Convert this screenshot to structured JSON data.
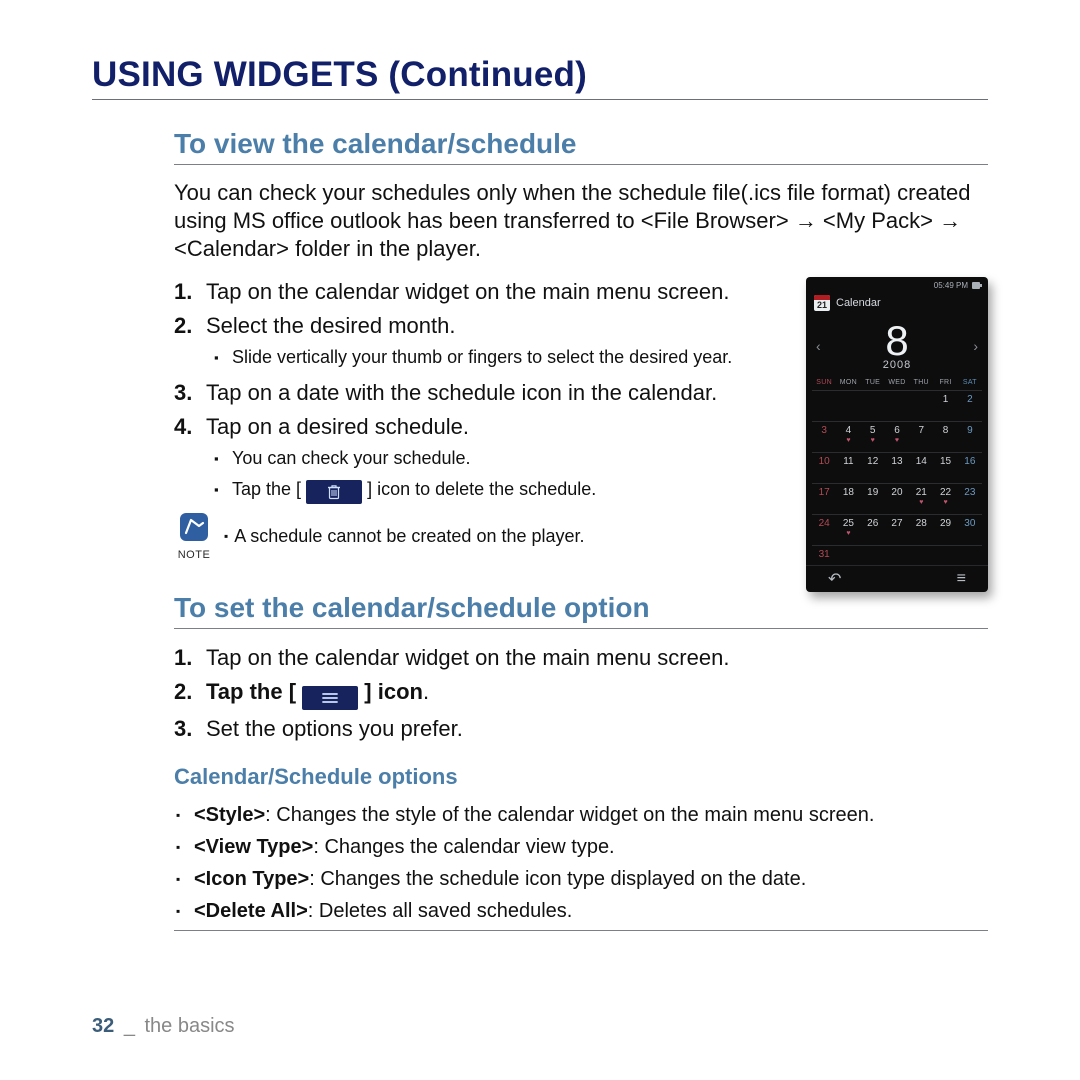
{
  "heading": "USING WIDGETS (Continued)",
  "section1": {
    "title": "To view the calendar/schedule",
    "intro": "You can check your schedules only when the schedule file(.ics file format) created using MS office outlook has been transferred to <File Browser> → <My Pack> → <Calendar> folder in the player.",
    "step1": "Tap on the calendar widget on the main menu screen.",
    "step2": "Select the desired month.",
    "step2_sub1": "Slide vertically your thumb or fingers to select the desired year.",
    "step3": "Tap on a date with the schedule icon in the calendar.",
    "step4": "Tap on a desired schedule.",
    "step4_sub1": "You can check your schedule.",
    "step4_sub2a": "Tap the [",
    "step4_sub2b": "] icon to delete the schedule.",
    "note_label": "NOTE",
    "note_text": "A schedule cannot be created on the player."
  },
  "section2": {
    "title": "To set the calendar/schedule option",
    "step1": "Tap on the calendar widget on the main menu screen.",
    "step2a": "Tap the [",
    "step2b": "] icon",
    "step2_dot": ".",
    "step3": "Set the options you prefer.",
    "options_title": "Calendar/Schedule options",
    "opt1_k": "<Style>",
    "opt1_v": ": Changes the style of the calendar widget on the main menu screen.",
    "opt2_k": "<View Type>",
    "opt2_v": ": Changes the calendar view type.",
    "opt3_k": "<Icon Type>",
    "opt3_v": ": Changes the schedule icon type displayed on the date.",
    "opt4_k": "<Delete All>",
    "opt4_v": ": Deletes all saved schedules."
  },
  "footer": {
    "page": "32",
    "underscore": "_",
    "section": "the basics"
  },
  "phone": {
    "status_time": "05:49 PM",
    "mini_day": "21",
    "app_title": "Calendar",
    "month": "8",
    "year": "2008",
    "dow": [
      "SUN",
      "MON",
      "TUE",
      "WED",
      "THU",
      "FRI",
      "SAT"
    ],
    "hearts": [
      4,
      5,
      6,
      21,
      22,
      25
    ],
    "weeks": [
      [
        "",
        "",
        "",
        "",
        "",
        "1",
        "2"
      ],
      [
        "3",
        "4",
        "5",
        "6",
        "7",
        "8",
        "9"
      ],
      [
        "10",
        "11",
        "12",
        "13",
        "14",
        "15",
        "16"
      ],
      [
        "17",
        "18",
        "19",
        "20",
        "21",
        "22",
        "23"
      ],
      [
        "24",
        "25",
        "26",
        "27",
        "28",
        "29",
        "30"
      ],
      [
        "31",
        "",
        "",
        "",
        "",
        "",
        ""
      ]
    ]
  }
}
